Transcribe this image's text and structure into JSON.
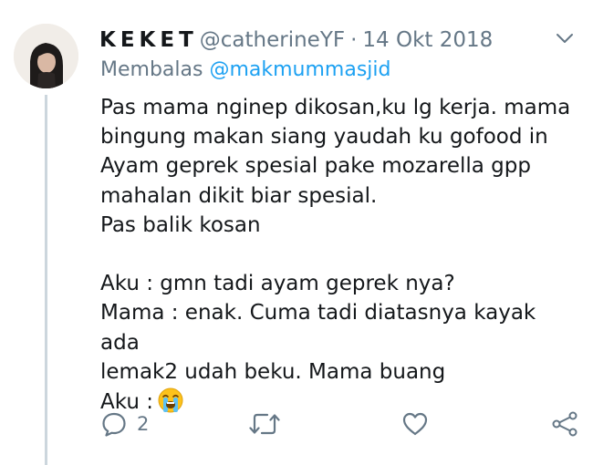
{
  "tweet": {
    "display_name": "KEKET",
    "handle": "@catherineYF",
    "separator": "·",
    "date": "14 Okt 2018",
    "replying_label": "Membalas",
    "replying_to": "@makmummasjid",
    "body": "Pas mama nginep dikosan,ku lg kerja. mama\nbingung makan siang yaudah ku gofood in\nAyam geprek spesial pake mozarella gpp\nmahalan dikit biar spesial.\nPas balik kosan\n\nAku : gmn tadi ayam geprek nya?\nMama : enak. Cuma tadi diatasnya kayak ada\nlemak2 udah beku. Mama buang\nAku :",
    "trailing_emoji": "loudly-crying-face"
  },
  "actions": {
    "reply_count": "2"
  },
  "colors": {
    "text": "#14171a",
    "muted": "#657786",
    "link": "#1da1f2",
    "thread_line": "#ccd6dd"
  }
}
